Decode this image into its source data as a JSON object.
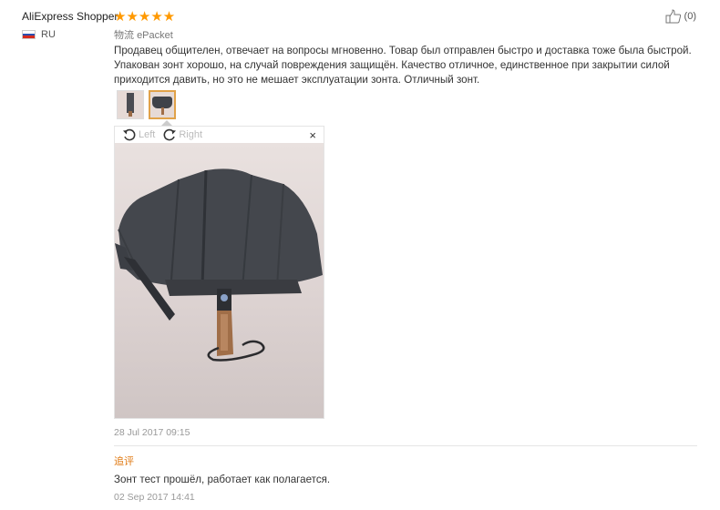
{
  "reviewer": {
    "name": "AliExpress Shopper",
    "country": "RU"
  },
  "rating": {
    "stars": "★★★★★",
    "value": 5,
    "max": 5
  },
  "logistics": {
    "label": "物流",
    "service": "ePacket"
  },
  "helpful": {
    "count": "(0)"
  },
  "feedback": {
    "text": "Продавец общителен, отвечает на вопросы мгновенно. Товар был отправлен быстро и доставка тоже была быстрой. Упакован зонт хорошо, на случай повреждения защищён. Качество отличное, единственное при закрытии силой приходится давить, но это не мешает эксплуатации зонта. Отличный зонт.",
    "date": "28 Jul 2017 09:15"
  },
  "viewer": {
    "rotate_left": "Left",
    "rotate_right": "Right",
    "close": "×"
  },
  "followup": {
    "label": "追评",
    "text": "Зонт тест прошёл, работает как полагается.",
    "date": "02 Sep 2017 14:41"
  },
  "colors": {
    "star": "#ff9900",
    "followup_label": "#e07a14",
    "thumb_active_border": "#e0a24a"
  }
}
